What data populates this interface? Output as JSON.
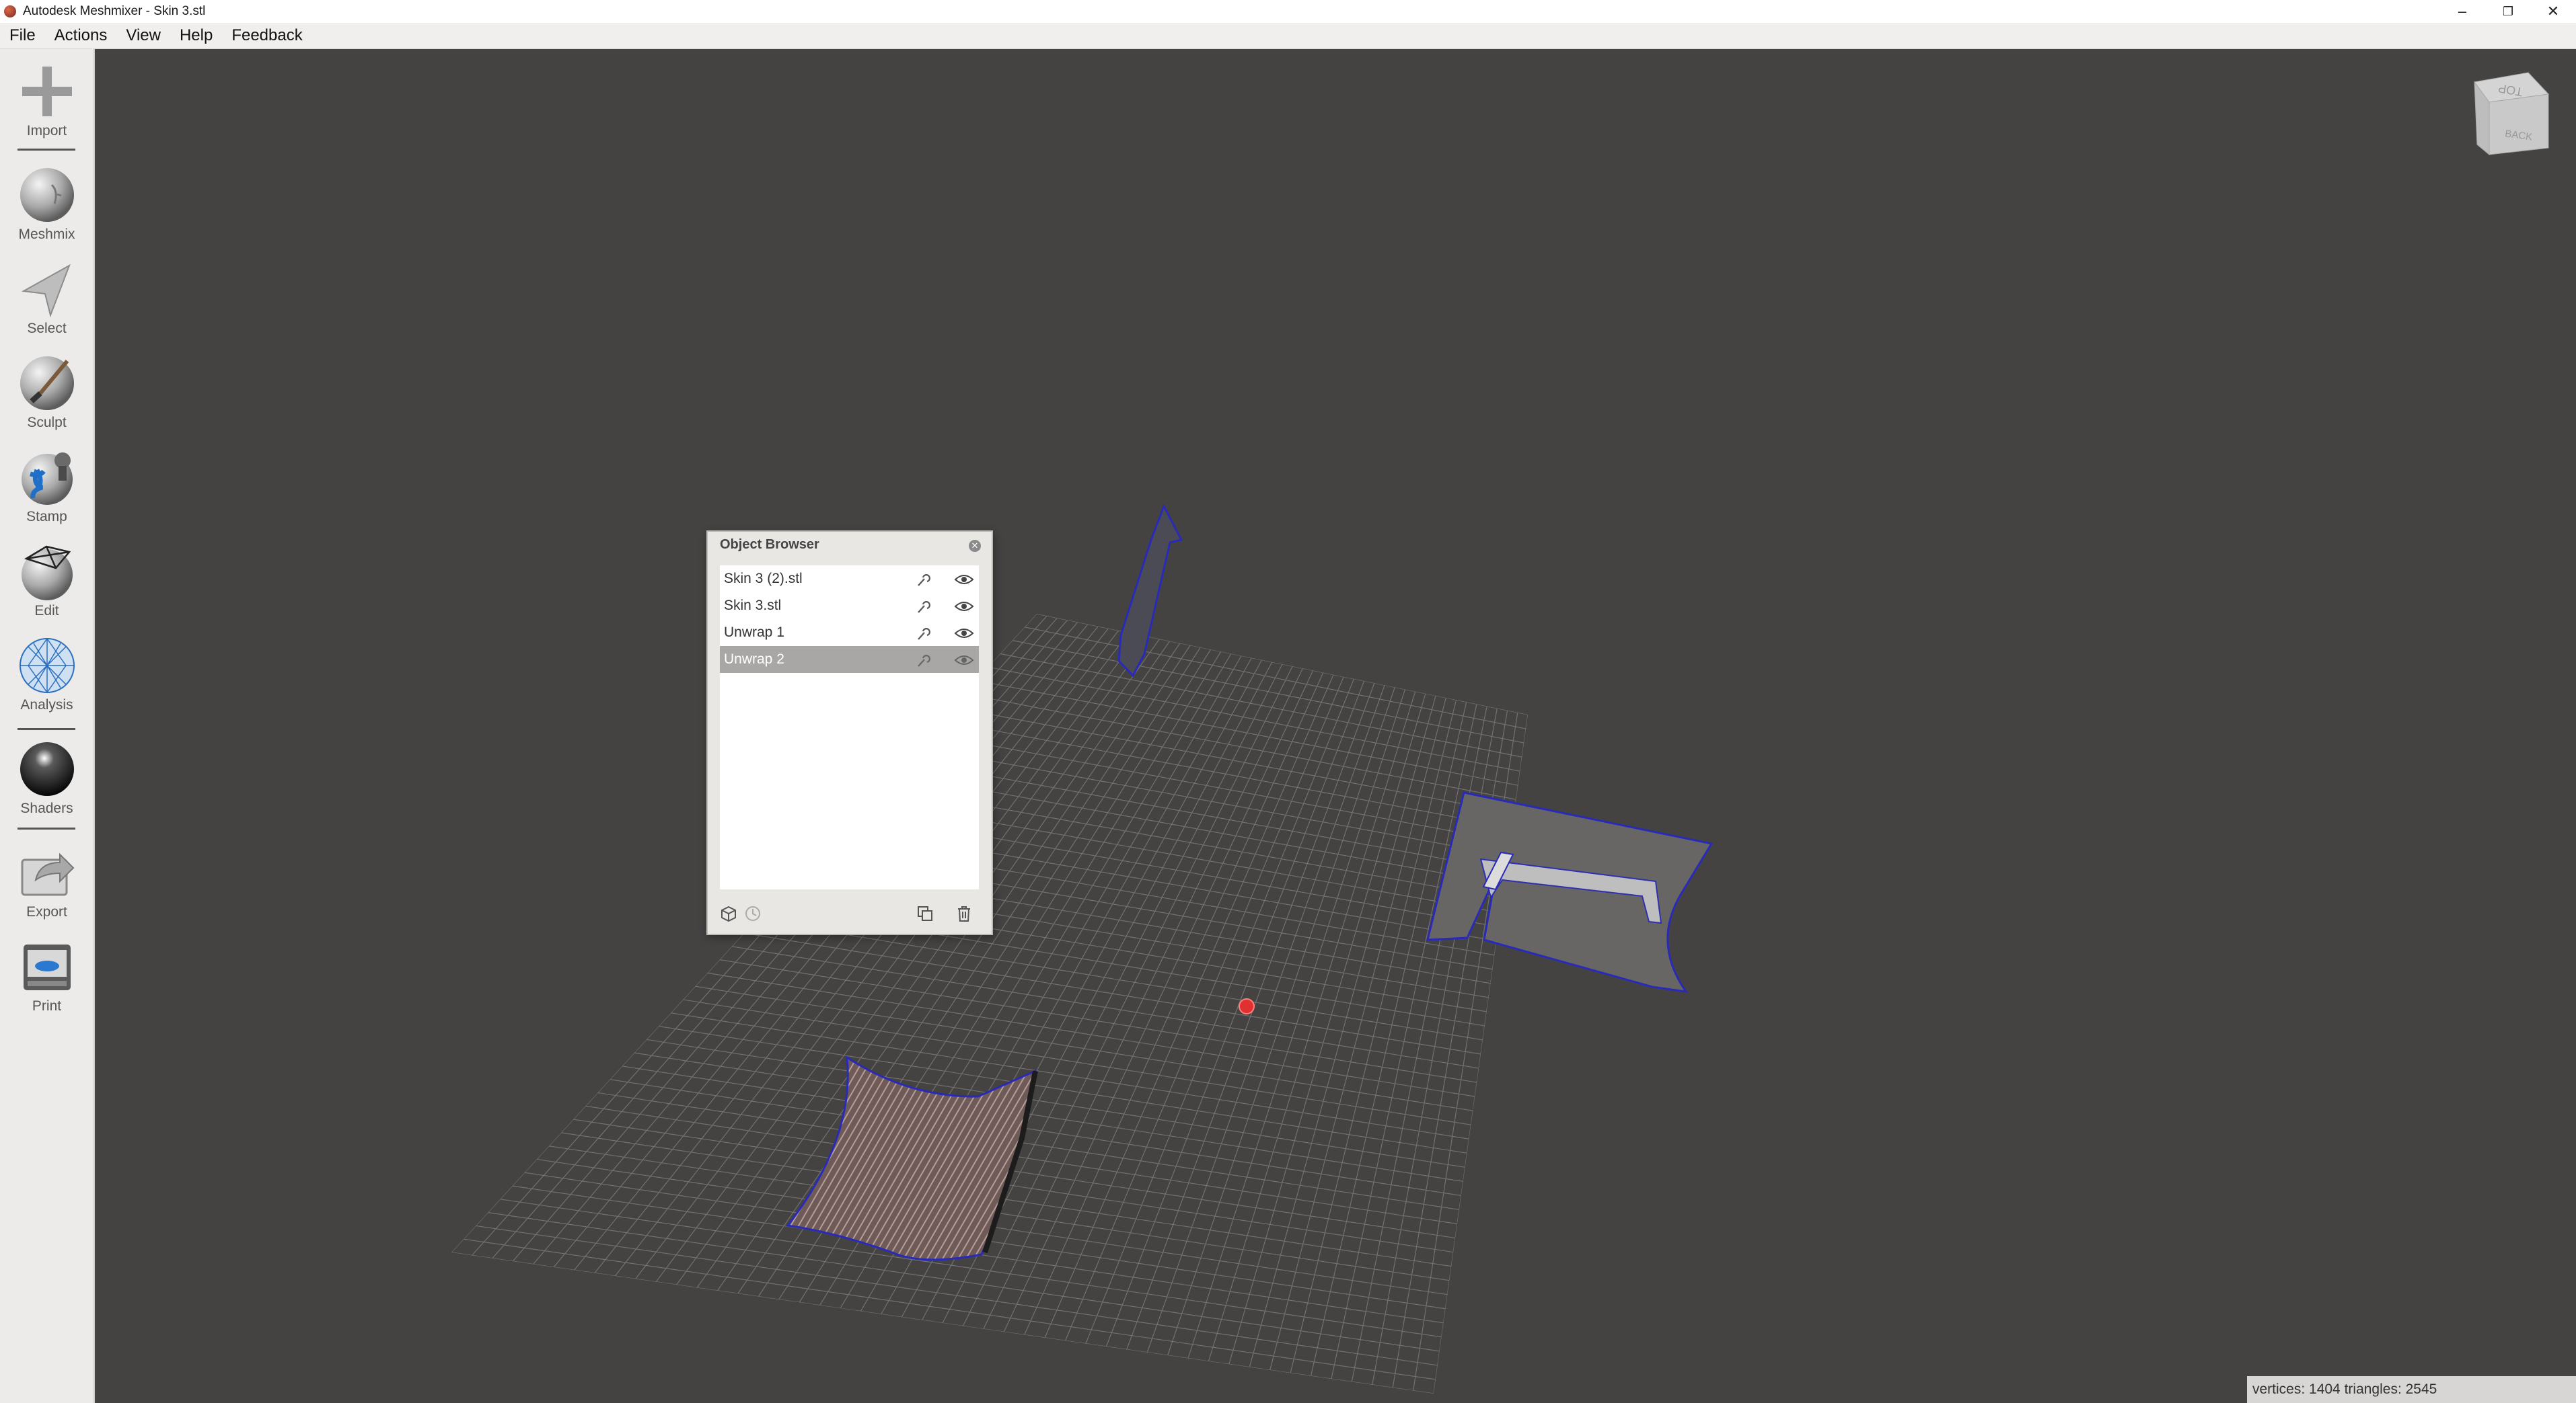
{
  "window": {
    "title": "Autodesk Meshmixer - Skin 3.stl"
  },
  "menu": [
    "File",
    "Actions",
    "View",
    "Help",
    "Feedback"
  ],
  "toolbar": {
    "tools": [
      {
        "label": "Import",
        "icon": "plus-icon"
      },
      {
        "label": "Meshmix",
        "icon": "meshmix-head-icon"
      },
      {
        "label": "Select",
        "icon": "arrow-cursor-icon"
      },
      {
        "label": "Sculpt",
        "icon": "brush-sphere-icon"
      },
      {
        "label": "Stamp",
        "icon": "stamp-sphere-icon"
      },
      {
        "label": "Edit",
        "icon": "edit-sphere-icon"
      },
      {
        "label": "Analysis",
        "icon": "analysis-sphere-icon"
      },
      {
        "label": "Shaders",
        "icon": "shader-sphere-icon"
      },
      {
        "label": "Export",
        "icon": "export-icon"
      },
      {
        "label": "Print",
        "icon": "printer-icon"
      }
    ]
  },
  "object_browser": {
    "title": "Object Browser",
    "items": [
      {
        "name": "Skin 3 (2).stl",
        "selected": false
      },
      {
        "name": "Skin 3.stl",
        "selected": false
      },
      {
        "name": "Unwrap 1",
        "selected": false
      },
      {
        "name": "Unwrap 2",
        "selected": true
      }
    ]
  },
  "view_cube": {
    "top_label": "TOP",
    "back_label": "BACK"
  },
  "status": {
    "text": "vertices: 1404 triangles: 2545"
  },
  "colors": {
    "viewport_bg": "#444342",
    "mesh_outline": "#2a2ab8",
    "pivot": "#e03030"
  }
}
